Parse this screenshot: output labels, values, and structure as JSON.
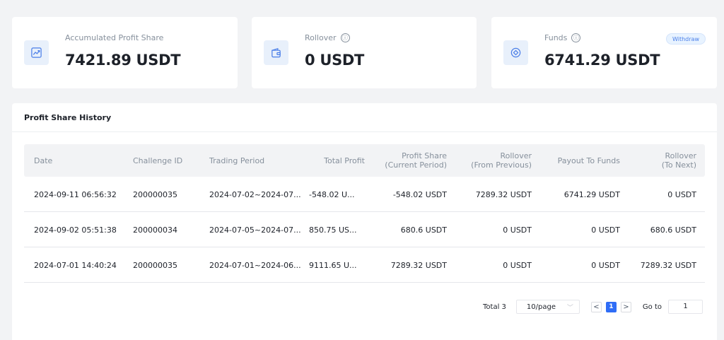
{
  "cards": [
    {
      "label": "Accumulated Profit Share",
      "value": "7421.89 USDT",
      "icon": "chart-trend-icon"
    },
    {
      "label": "Rollover",
      "value": "0 USDT",
      "icon": "wallet-icon",
      "info": "ⓘ"
    },
    {
      "label": "Funds",
      "value": "6741.29 USDT",
      "icon": "coin-icon",
      "info": "ⓘ",
      "action": "Withdraw"
    }
  ],
  "history": {
    "title": "Profit Share History",
    "columns": {
      "date": "Date",
      "challenge_id": "Challenge ID",
      "trading_period": "Trading Period",
      "total_profit": "Total Profit",
      "profit_share_1": "Profit Share",
      "profit_share_2": "(Current Period)",
      "rollover_prev_1": "Rollover",
      "rollover_prev_2": "(From Previous)",
      "payout": "Payout To Funds",
      "rollover_next_1": "Rollover",
      "rollover_next_2": "(To Next)"
    },
    "rows": [
      {
        "date": "2024-09-11 06:56:32",
        "challenge_id": "200000035",
        "trading_period": "2024-07-02~2024-07...",
        "total_profit": "-548.02 U...",
        "profit_share": "-548.02 USDT",
        "rollover_prev": "7289.32 USDT",
        "payout": "6741.29 USDT",
        "rollover_next": "0 USDT"
      },
      {
        "date": "2024-09-02 05:51:38",
        "challenge_id": "200000034",
        "trading_period": "2024-07-05~2024-07...",
        "total_profit": "850.75 US...",
        "profit_share": "680.6 USDT",
        "rollover_prev": "0 USDT",
        "payout": "0 USDT",
        "rollover_next": "680.6 USDT"
      },
      {
        "date": "2024-07-01 14:40:24",
        "challenge_id": "200000035",
        "trading_period": "2024-07-01~2024-06...",
        "total_profit": "9111.65 U...",
        "profit_share": "7289.32 USDT",
        "rollover_prev": "0 USDT",
        "payout": "0 USDT",
        "rollover_next": "7289.32 USDT"
      }
    ]
  },
  "pagination": {
    "total": "Total 3",
    "page_size": "10/page",
    "prev": "<",
    "current_page": "1",
    "next": ">",
    "goto_label": "Go to",
    "goto_value": "1"
  },
  "colors": {
    "accent": "#2f6df6",
    "background": "#f2f3f5",
    "icon_bg": "#e8f0fb"
  }
}
